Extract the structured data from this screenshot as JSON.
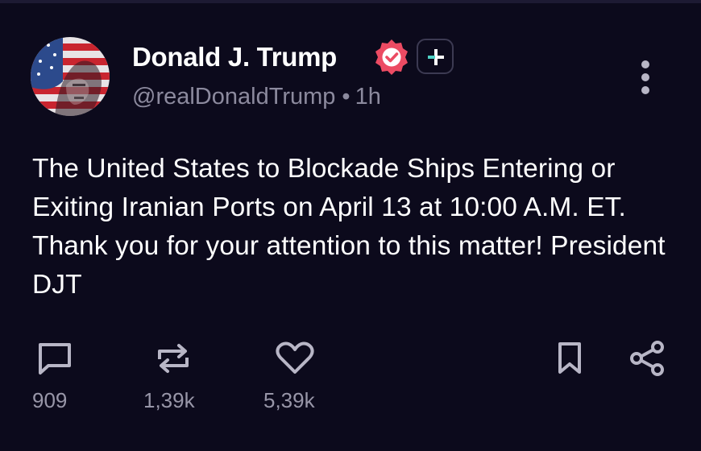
{
  "author": {
    "display_name": "Donald J. Trump",
    "handle": "@realDonaldTrump",
    "separator": "•",
    "time_ago": "1h",
    "verified": true
  },
  "post": {
    "text": "The United States to Blockade Ships Entering or Exiting Iranian Ports on April 13 at 10:00 A.M. ET. Thank you for your attention to this matter! President DJT"
  },
  "actions": {
    "reply_count": "909",
    "repost_count": "1,39k",
    "like_count": "5,39k"
  },
  "icons": {
    "verified": "verified-badge-icon",
    "follow": "plus-icon",
    "more": "more-vertical-icon",
    "reply": "comment-icon",
    "repost": "repost-icon",
    "like": "heart-icon",
    "bookmark": "bookmark-icon",
    "share": "share-icon"
  },
  "colors": {
    "background": "#0c0a1c",
    "text_primary": "#ffffff",
    "text_secondary": "#8c8a9e",
    "icon": "#b8b6c6",
    "verified_badge": "#ec4b63",
    "follow_plus_accent": "#4fd1c5"
  }
}
